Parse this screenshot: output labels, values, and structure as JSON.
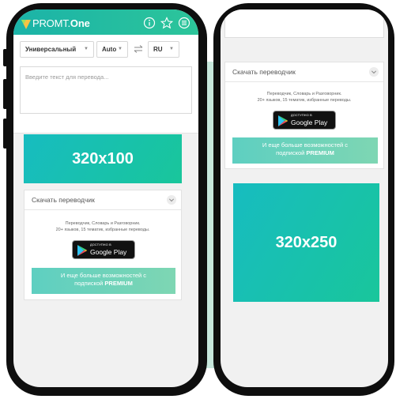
{
  "app": {
    "logo_text": "PROMT.",
    "logo_text_bold": "One",
    "brand_color": "#1bb3a8"
  },
  "header": {
    "icons": [
      "info-icon",
      "star-icon",
      "menu-icon"
    ]
  },
  "translator": {
    "mode_select": "Универсальный",
    "source_lang": "Auto",
    "target_lang": "RU",
    "input_placeholder": "Введите текст для перевода..."
  },
  "ads": {
    "banner_small": "320x100",
    "banner_large": "320x250"
  },
  "download_card": {
    "title": "Скачать переводчик",
    "desc_line1": "Переводчик, Словарь и Разговорник.",
    "desc_line2": "20+ языков, 15 тематик, избранные переводы.",
    "gplay_small": "ДОСТУПНО В",
    "gplay_big": "Google Play",
    "premium_line1": "И еще больше возможностей с",
    "premium_prefix": "подпиской ",
    "premium_bold": "PREMIUM"
  }
}
